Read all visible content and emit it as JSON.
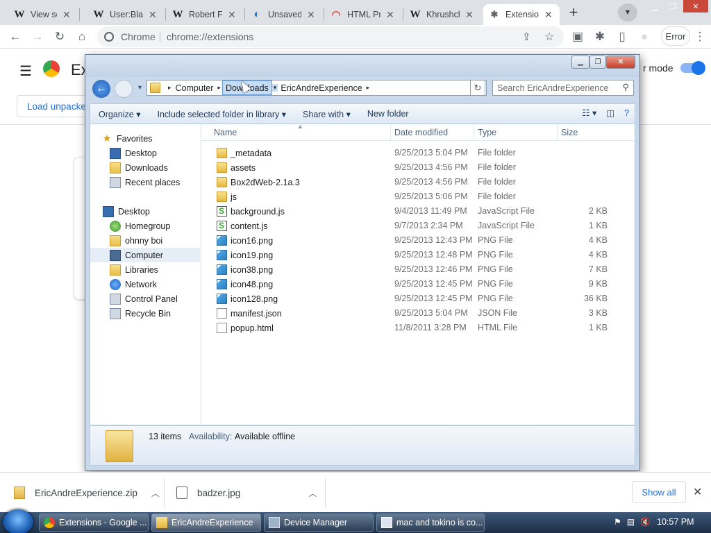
{
  "browser": {
    "tabs": [
      {
        "title": "View sou",
        "icon": "W"
      },
      {
        "title": "User:Blat",
        "icon": "W"
      },
      {
        "title": "Robert F",
        "icon": "W"
      },
      {
        "title": "Unsaved",
        "icon": "e"
      },
      {
        "title": "HTML Pr",
        "icon": "rainbow"
      },
      {
        "title": "Khrushcl",
        "icon": "W"
      },
      {
        "title": "Extensio",
        "icon": "puzzle"
      }
    ],
    "omnibox_site": "Chrome",
    "omnibox_url": "chrome://extensions",
    "profile_label": "Error"
  },
  "extensions_page": {
    "title": "Ex",
    "dev_mode_label": "r mode",
    "load_unpacked_label": "Load unpacke"
  },
  "explorer": {
    "breadcrumbs": [
      "Computer",
      "Downloads",
      "EricAndreExperience"
    ],
    "search_placeholder": "Search EricAndreExperience",
    "commands": [
      "Organize",
      "Include selected folder in library",
      "Share with",
      "New folder"
    ],
    "nav": [
      {
        "label": "Favorites",
        "icon": "star-icon",
        "level": 0
      },
      {
        "label": "Desktop",
        "icon": "desktop-icon",
        "level": 1
      },
      {
        "label": "Downloads",
        "icon": "folder-icon",
        "level": 1
      },
      {
        "label": "Recent places",
        "icon": "recent-icon",
        "level": 1
      },
      {
        "label": "Desktop",
        "icon": "desktop-icon",
        "level": 0
      },
      {
        "label": "Homegroup",
        "icon": "homegroup-icon",
        "level": 1
      },
      {
        "label": "ohnny boi",
        "icon": "folder-icon",
        "level": 1
      },
      {
        "label": "Computer",
        "icon": "computer-icon",
        "level": 1,
        "selected": true
      },
      {
        "label": "Libraries",
        "icon": "folder-icon",
        "level": 1
      },
      {
        "label": "Network",
        "icon": "network-icon",
        "level": 1
      },
      {
        "label": "Control Panel",
        "icon": "control-panel-icon",
        "level": 1
      },
      {
        "label": "Recycle Bin",
        "icon": "recycle-bin-icon",
        "level": 1
      }
    ],
    "columns": {
      "name": "Name",
      "date": "Date modified",
      "type": "Type",
      "size": "Size"
    },
    "files": [
      {
        "name": "_metadata",
        "date": "9/25/2013 5:04 PM",
        "type": "File folder",
        "size": "",
        "icon": "folder"
      },
      {
        "name": "assets",
        "date": "9/25/2013 4:56 PM",
        "type": "File folder",
        "size": "",
        "icon": "folder"
      },
      {
        "name": "Box2dWeb-2.1a.3",
        "date": "9/25/2013 4:56 PM",
        "type": "File folder",
        "size": "",
        "icon": "folder"
      },
      {
        "name": "js",
        "date": "9/25/2013 5:06 PM",
        "type": "File folder",
        "size": "",
        "icon": "folder"
      },
      {
        "name": "background.js",
        "date": "9/4/2013 11:49 PM",
        "type": "JavaScript File",
        "size": "2 KB",
        "icon": "js"
      },
      {
        "name": "content.js",
        "date": "9/7/2013 2:34 PM",
        "type": "JavaScript File",
        "size": "1 KB",
        "icon": "js"
      },
      {
        "name": "icon16.png",
        "date": "9/25/2013 12:43 PM",
        "type": "PNG File",
        "size": "4 KB",
        "icon": "png"
      },
      {
        "name": "icon19.png",
        "date": "9/25/2013 12:48 PM",
        "type": "PNG File",
        "size": "4 KB",
        "icon": "png"
      },
      {
        "name": "icon38.png",
        "date": "9/25/2013 12:46 PM",
        "type": "PNG File",
        "size": "7 KB",
        "icon": "png"
      },
      {
        "name": "icon48.png",
        "date": "9/25/2013 12:45 PM",
        "type": "PNG File",
        "size": "9 KB",
        "icon": "png"
      },
      {
        "name": "icon128.png",
        "date": "9/25/2013 12:45 PM",
        "type": "PNG File",
        "size": "36 KB",
        "icon": "png"
      },
      {
        "name": "manifest.json",
        "date": "9/25/2013 5:04 PM",
        "type": "JSON File",
        "size": "3 KB",
        "icon": "doc"
      },
      {
        "name": "popup.html",
        "date": "11/8/2011 3:28 PM",
        "type": "HTML File",
        "size": "1 KB",
        "icon": "html"
      }
    ],
    "details": {
      "count": "13 items",
      "availability_label": "Availability:",
      "availability_value": "Available offline"
    }
  },
  "downloads": {
    "items": [
      {
        "name": "EricAndreExperience.zip",
        "icon": "zip-icon"
      },
      {
        "name": "badzer.jpg",
        "icon": "image-icon"
      }
    ],
    "show_all_label": "Show all"
  },
  "taskbar": {
    "buttons": [
      {
        "label": "Extensions - Google ...",
        "icon": "chrome-icon"
      },
      {
        "label": "EricAndreExperience",
        "icon": "folder-icon",
        "active": true
      },
      {
        "label": "Device Manager",
        "icon": "device-manager-icon"
      },
      {
        "label": "mac and tokino is co...",
        "icon": "window-icon"
      }
    ],
    "clock": "10:57 PM"
  },
  "colors": {
    "accent": "#1a73e8",
    "explorer_frame": "#c9d8ea",
    "taskbar": "#1c2f48"
  }
}
